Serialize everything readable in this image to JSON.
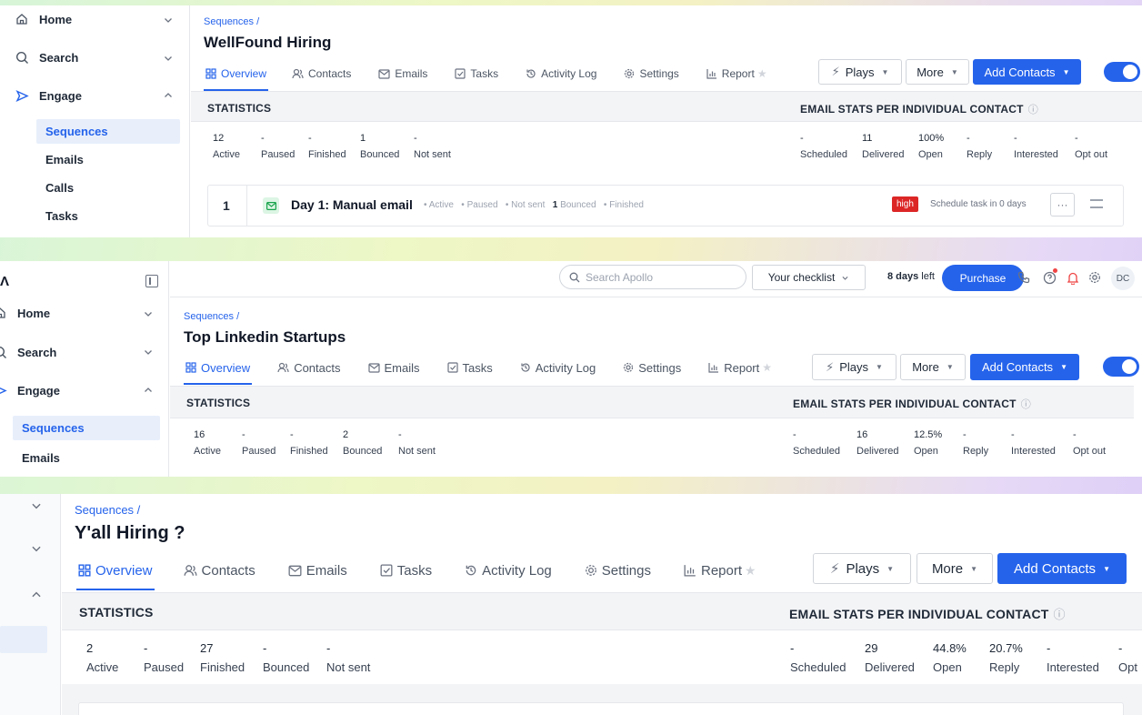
{
  "panels": [
    {
      "nav": {
        "home": "Home",
        "search": "Search",
        "engage": "Engage",
        "sub": [
          "Sequences",
          "Emails",
          "Calls",
          "Tasks"
        ]
      },
      "breadcrumb": "Sequences /",
      "title": "WellFound Hiring",
      "tabs": [
        "Overview",
        "Contacts",
        "Emails",
        "Tasks",
        "Activity Log",
        "Settings",
        "Report"
      ],
      "buttons": {
        "plays": "Plays",
        "more": "More",
        "add": "Add Contacts"
      },
      "stats_title": "STATISTICS",
      "email_stats_title": "EMAIL STATS PER INDIVIDUAL CONTACT",
      "stats": [
        {
          "value": "12",
          "label": "Active"
        },
        {
          "value": "-",
          "label": "Paused"
        },
        {
          "value": "-",
          "label": "Finished"
        },
        {
          "value": "1",
          "label": "Bounced"
        },
        {
          "value": "-",
          "label": "Not sent"
        }
      ],
      "email_stats": [
        {
          "value": "-",
          "label": "Scheduled"
        },
        {
          "value": "11",
          "label": "Delivered"
        },
        {
          "value": "100%",
          "label": "Open"
        },
        {
          "value": "-",
          "label": "Reply"
        },
        {
          "value": "-",
          "label": "Interested"
        },
        {
          "value": "-",
          "label": "Opt out"
        }
      ],
      "step": {
        "number": "1",
        "title": "Day 1: Manual email",
        "active": "Active",
        "paused": "Paused",
        "not_sent": "Not sent",
        "bounced_count": "1",
        "bounced": "Bounced",
        "finished": "Finished",
        "priority": "high",
        "schedule": "Schedule task in 0 days"
      }
    },
    {
      "nav": {
        "home": "Home",
        "search": "Search",
        "engage": "Engage",
        "sub": [
          "Sequences",
          "Emails"
        ]
      },
      "topbar": {
        "search_placeholder": "Search Apollo",
        "checklist": "Your checklist",
        "days_strong": "8 days",
        "days_rest": " left",
        "purchase": "Purchase",
        "avatar": "DC"
      },
      "breadcrumb": "Sequences /",
      "title": "Top Linkedin Startups",
      "tabs": [
        "Overview",
        "Contacts",
        "Emails",
        "Tasks",
        "Activity Log",
        "Settings",
        "Report"
      ],
      "buttons": {
        "plays": "Plays",
        "more": "More",
        "add": "Add Contacts"
      },
      "stats_title": "STATISTICS",
      "email_stats_title": "EMAIL STATS PER INDIVIDUAL CONTACT",
      "stats": [
        {
          "value": "16",
          "label": "Active"
        },
        {
          "value": "-",
          "label": "Paused"
        },
        {
          "value": "-",
          "label": "Finished"
        },
        {
          "value": "2",
          "label": "Bounced"
        },
        {
          "value": "-",
          "label": "Not sent"
        }
      ],
      "email_stats": [
        {
          "value": "-",
          "label": "Scheduled"
        },
        {
          "value": "16",
          "label": "Delivered"
        },
        {
          "value": "12.5%",
          "label": "Open"
        },
        {
          "value": "-",
          "label": "Reply"
        },
        {
          "value": "-",
          "label": "Interested"
        },
        {
          "value": "-",
          "label": "Opt out"
        }
      ]
    },
    {
      "breadcrumb": "Sequences /",
      "title": "Y'all Hiring ?",
      "tabs": [
        "Overview",
        "Contacts",
        "Emails",
        "Tasks",
        "Activity Log",
        "Settings",
        "Report"
      ],
      "buttons": {
        "plays": "Plays",
        "more": "More",
        "add": "Add Contacts"
      },
      "stats_title": "STATISTICS",
      "email_stats_title": "EMAIL STATS PER INDIVIDUAL CONTACT",
      "stats": [
        {
          "value": "2",
          "label": "Active"
        },
        {
          "value": "-",
          "label": "Paused"
        },
        {
          "value": "27",
          "label": "Finished"
        },
        {
          "value": "-",
          "label": "Bounced"
        },
        {
          "value": "-",
          "label": "Not sent"
        }
      ],
      "email_stats": [
        {
          "value": "-",
          "label": "Scheduled"
        },
        {
          "value": "29",
          "label": "Delivered"
        },
        {
          "value": "44.8%",
          "label": "Open"
        },
        {
          "value": "20.7%",
          "label": "Reply"
        },
        {
          "value": "-",
          "label": "Interested"
        },
        {
          "value": "-",
          "label": "Opt"
        }
      ]
    }
  ],
  "colors": {
    "accent": "#2563eb",
    "high": "#dc2626",
    "background_gradient": [
      "#d7f5d9",
      "#eef7c6",
      "#dccdf7"
    ]
  },
  "icons": [
    "home-icon",
    "search-icon",
    "engage-icon",
    "chevron-down-icon",
    "chevron-up-icon",
    "grid-icon",
    "contacts-icon",
    "mail-icon",
    "tasks-icon",
    "history-icon",
    "gear-icon",
    "report-icon",
    "star-icon",
    "bolt-icon",
    "info-icon",
    "phone-icon",
    "help-icon",
    "bell-icon",
    "collapse-icon"
  ]
}
